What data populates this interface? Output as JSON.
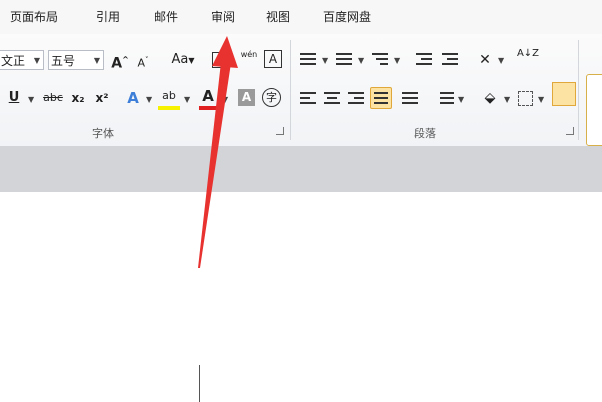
{
  "tabs": [
    "页面布局",
    "引用",
    "邮件",
    "审阅",
    "视图",
    "百度网盘"
  ],
  "font": {
    "family_value": "文正",
    "size_value": "五号",
    "grow_label": "A",
    "shrink_label": "A",
    "case_label": "Aa",
    "phonetic_label": "wén",
    "border_char": "A",
    "underline_label": "U",
    "strike_label": "abc",
    "subscript_label": "x₂",
    "superscript_label": "x²",
    "effects_label": "A",
    "highlight_label": "ab",
    "color_label": "A",
    "shading_label": "A",
    "enclose_label": "字",
    "group_label": "字体"
  },
  "paragraph": {
    "group_label": "段落",
    "sort_label": "A↓Z",
    "active_align": "justify"
  },
  "annotation": {
    "arrow_color": "#e8322f"
  },
  "colors": {
    "highlight": "#f7f300",
    "font_color": "#e02020",
    "selected": "#fde3a3"
  }
}
